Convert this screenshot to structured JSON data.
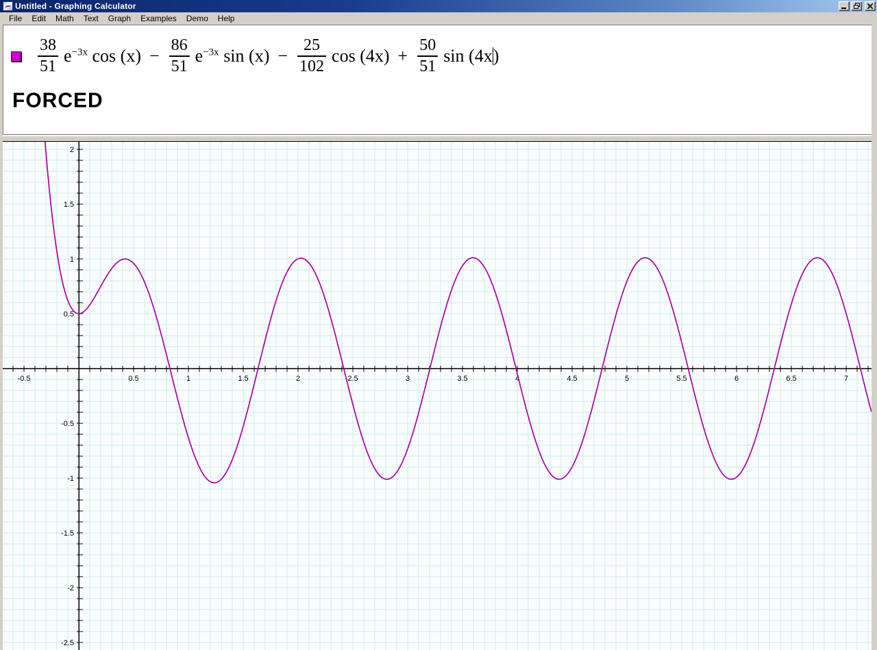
{
  "window": {
    "title": "Untitled - Graphing Calculator",
    "icons": {
      "app": "graphing-calculator-icon",
      "minimize": "minimize-icon",
      "restore": "restore-icon",
      "close": "close-icon"
    }
  },
  "menu": {
    "items": [
      "File",
      "Edit",
      "Math",
      "Text",
      "Graph",
      "Examples",
      "Demo",
      "Help"
    ]
  },
  "equation_panel": {
    "marker_color": "#cc00cc",
    "equation": {
      "f1n": "38",
      "f1d": "51",
      "e1base": "e",
      "e1exp": "−3x",
      "t1": "cos (x)",
      "op1": "−",
      "f2n": "86",
      "f2d": "51",
      "e2base": "e",
      "e2exp": "−3x",
      "t2": "sin (x)",
      "op2": "−",
      "f3n": "25",
      "f3d": "102",
      "t3": "cos (4x)",
      "op3": "+",
      "f4n": "50",
      "f4d": "51",
      "t4a": "sin (4x",
      "t4b": ")"
    },
    "label": "FORCED"
  },
  "chart_data": {
    "type": "line",
    "title": "",
    "function": "y = (38/51)e^(-3x)cos(x) - (86/51)e^(-3x)sin(x) - (25/102)cos(4x) + (50/51)sin(4x)",
    "series_terms": [
      {
        "sign": 1,
        "num": 38,
        "den": 51,
        "decay": -3,
        "trig": "cos",
        "freq": 1
      },
      {
        "sign": -1,
        "num": 86,
        "den": 51,
        "decay": -3,
        "trig": "sin",
        "freq": 1
      },
      {
        "sign": -1,
        "num": 25,
        "den": 102,
        "decay": 0,
        "trig": "cos",
        "freq": 4
      },
      {
        "sign": 1,
        "num": 50,
        "den": 51,
        "decay": 0,
        "trig": "sin",
        "freq": 4
      }
    ],
    "x_range": [
      -0.69,
      7.23
    ],
    "y_range": [
      -2.57,
      2.07
    ],
    "grid_step": 0.1,
    "tick_step": 0.1,
    "label_step": 0.5,
    "x_tick_labels": [
      "-0.5",
      "0.5",
      "1",
      "1.5",
      "2",
      "2.5",
      "3",
      "3.5",
      "4",
      "4.5",
      "5",
      "5.5",
      "6",
      "6.5",
      "7"
    ],
    "y_tick_labels": [
      "2",
      "1.5",
      "1",
      "0.5",
      "-0.5",
      "-1",
      "-1.5",
      "-2",
      "-2.5"
    ],
    "grid_on": true,
    "curve_color": "#a800a8",
    "grid_color": "#cfeaea",
    "axis_color": "#000000",
    "plot_bg": "#fafdfd"
  }
}
